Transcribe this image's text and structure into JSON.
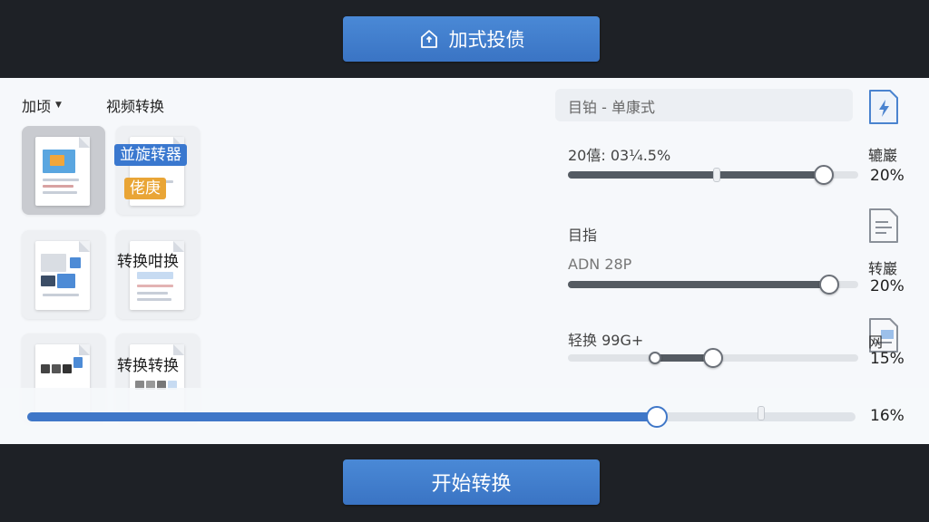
{
  "toolbar": {
    "add_label": "加式投债",
    "add_icon": "home-upload-icon"
  },
  "header": {
    "dropdown_label": "加顷",
    "tab_label": "视频转换"
  },
  "thumbs": [
    {
      "tag_blue": "並旋转器",
      "tag_orange": "佬庚"
    },
    {
      "label": "转换咁换"
    },
    {
      "label": "转换转换"
    }
  ],
  "format": {
    "placeholder": "目铂 - 单康式"
  },
  "params": [
    {
      "label": "20僖: 03¼.5%",
      "side_label": "辘巖",
      "percent": "20%",
      "value": 0.88,
      "icon": "lightning-doc-icon"
    },
    {
      "label": "目指",
      "sub_label": "ADN 28P",
      "side_label": "转巖",
      "percent": "20%",
      "value": 0.9,
      "icon": "text-doc-icon"
    },
    {
      "label": "轻换 99G+",
      "side_label": "网",
      "percent": "15%",
      "range": [
        0.3,
        0.5
      ],
      "icon": "image-doc-icon"
    }
  ],
  "progress": {
    "percent": "16%",
    "value": 0.76
  },
  "footer": {
    "start_label": "开始转换"
  },
  "colors": {
    "accent": "#3f77c8",
    "tag_orange": "#e9a536",
    "background": "#1e2126"
  }
}
